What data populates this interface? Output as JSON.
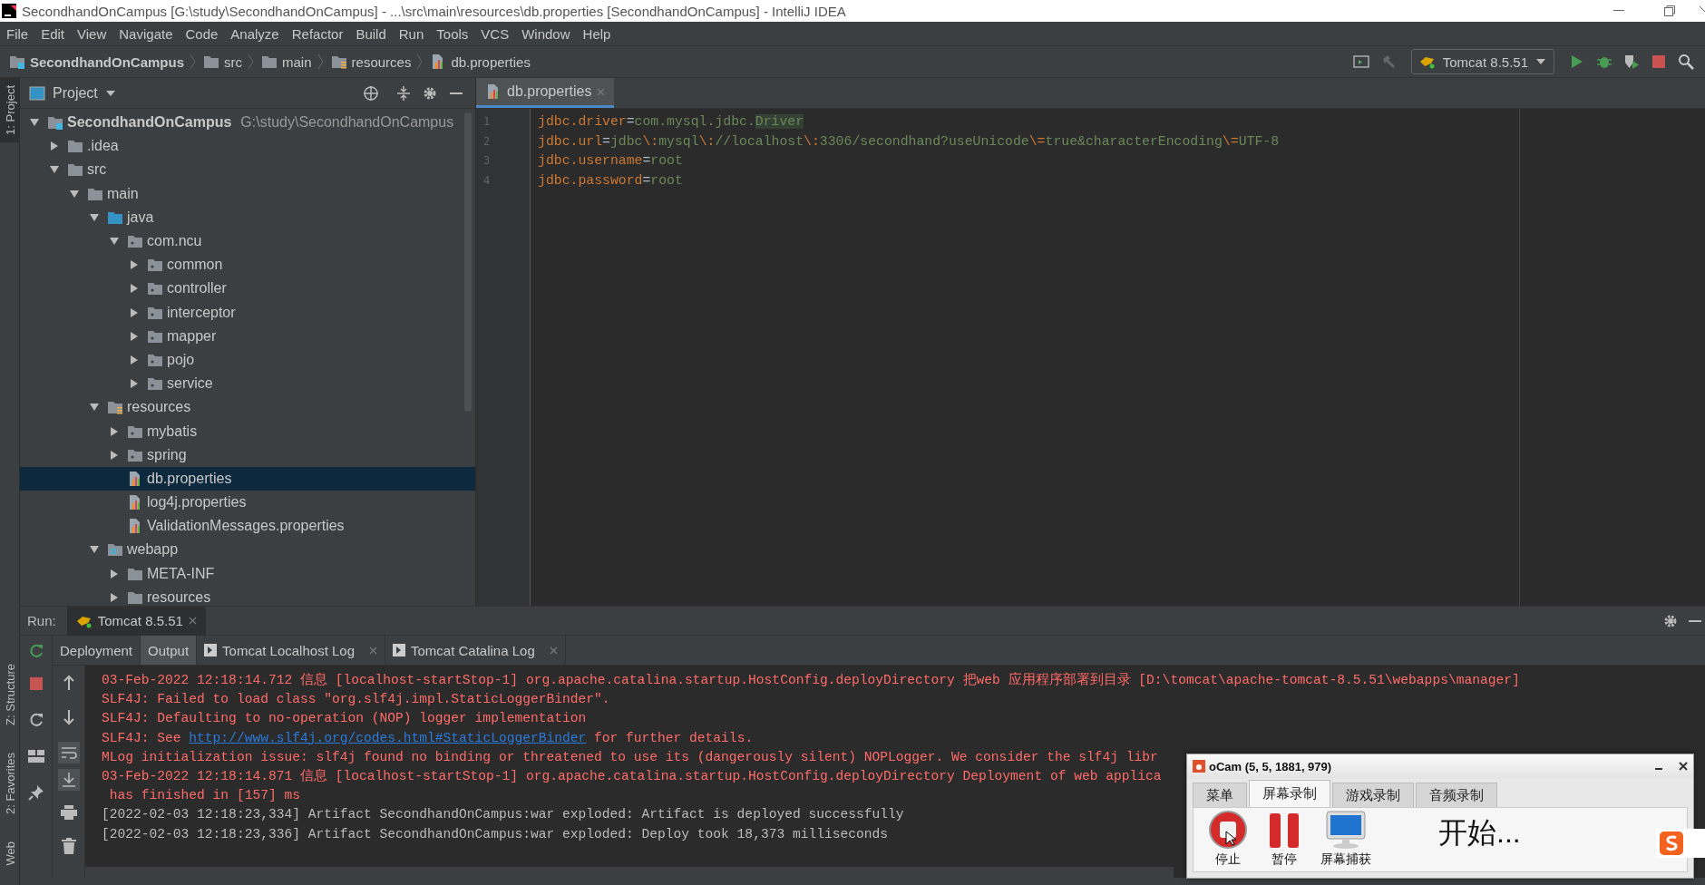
{
  "window": {
    "title": "SecondhandOnCampus [G:\\study\\SecondhandOnCampus] - ...\\src\\main\\resources\\db.properties [SecondhandOnCampus] - IntelliJ IDEA"
  },
  "menu": [
    "File",
    "Edit",
    "View",
    "Navigate",
    "Code",
    "Analyze",
    "Refactor",
    "Build",
    "Run",
    "Tools",
    "VCS",
    "Window",
    "Help"
  ],
  "breadcrumbs": [
    {
      "label": "SecondhandOnCampus",
      "kind": "module"
    },
    {
      "label": "src",
      "kind": "folder"
    },
    {
      "label": "main",
      "kind": "folder"
    },
    {
      "label": "resources",
      "kind": "resources"
    },
    {
      "label": "db.properties",
      "kind": "properties"
    }
  ],
  "run_config": {
    "label": "Tomcat 8.5.51"
  },
  "side_tabs": [
    {
      "label": "1: Project",
      "selected": true,
      "kind": "top"
    },
    {
      "label": "Z: Structure",
      "selected": false,
      "kind": "bottom"
    },
    {
      "label": "2: Favorites",
      "selected": false,
      "kind": "bottom"
    },
    {
      "label": "Web",
      "selected": false,
      "kind": "bottom"
    }
  ],
  "project_panel": {
    "title": "Project",
    "tree": [
      {
        "label": "SecondhandOnCampus",
        "path": "G:\\study\\SecondhandOnCampus",
        "kind": "module",
        "expanded": true,
        "selected": false,
        "children": [
          {
            "label": ".idea",
            "kind": "folder",
            "expanded": false,
            "selected": false
          },
          {
            "label": "src",
            "kind": "folder",
            "expanded": true,
            "selected": false,
            "children": [
              {
                "label": "main",
                "kind": "folder",
                "expanded": true,
                "selected": false,
                "children": [
                  {
                    "label": "java",
                    "kind": "source",
                    "expanded": true,
                    "selected": false,
                    "children": [
                      {
                        "label": "com.ncu",
                        "kind": "package",
                        "expanded": true,
                        "selected": false,
                        "children": [
                          {
                            "label": "common",
                            "kind": "package",
                            "expanded": false,
                            "selected": false
                          },
                          {
                            "label": "controller",
                            "kind": "package",
                            "expanded": false,
                            "selected": false
                          },
                          {
                            "label": "interceptor",
                            "kind": "package",
                            "expanded": false,
                            "selected": false
                          },
                          {
                            "label": "mapper",
                            "kind": "package",
                            "expanded": false,
                            "selected": false
                          },
                          {
                            "label": "pojo",
                            "kind": "package",
                            "expanded": false,
                            "selected": false
                          },
                          {
                            "label": "service",
                            "kind": "package",
                            "expanded": false,
                            "selected": false
                          }
                        ]
                      }
                    ]
                  },
                  {
                    "label": "resources",
                    "kind": "resources",
                    "expanded": true,
                    "selected": false,
                    "children": [
                      {
                        "label": "mybatis",
                        "kind": "package",
                        "expanded": false,
                        "selected": false
                      },
                      {
                        "label": "spring",
                        "kind": "package",
                        "expanded": false,
                        "selected": false
                      },
                      {
                        "label": "db.properties",
                        "kind": "properties",
                        "selected": true
                      },
                      {
                        "label": "log4j.properties",
                        "kind": "properties",
                        "selected": false
                      },
                      {
                        "label": "ValidationMessages.properties",
                        "kind": "properties",
                        "selected": false
                      }
                    ]
                  },
                  {
                    "label": "webapp",
                    "kind": "web",
                    "expanded": true,
                    "selected": false,
                    "children": [
                      {
                        "label": "META-INF",
                        "kind": "folder",
                        "expanded": false,
                        "selected": false
                      },
                      {
                        "label": "resources",
                        "kind": "folder",
                        "expanded": false,
                        "selected": false
                      }
                    ]
                  }
                ]
              }
            ]
          }
        ]
      }
    ]
  },
  "editor": {
    "tabs": [
      {
        "label": "db.properties",
        "selected": true
      }
    ],
    "lines": [
      {
        "number": "1",
        "parts": [
          {
            "text": "jdbc.driver",
            "kind": "key"
          },
          {
            "text": "=",
            "kind": "sep"
          },
          {
            "text": "com.mysql.jdbc.",
            "kind": "value"
          },
          {
            "text": "Driver",
            "kind": "highlight"
          }
        ]
      },
      {
        "number": "2",
        "parts": [
          {
            "text": "jdbc.url",
            "kind": "key"
          },
          {
            "text": "=",
            "kind": "sep"
          },
          {
            "text": "jdbc",
            "kind": "value"
          },
          {
            "text": "\\:",
            "kind": "escape"
          },
          {
            "text": "mysql",
            "kind": "value"
          },
          {
            "text": "\\:",
            "kind": "escape"
          },
          {
            "text": "//localhost",
            "kind": "value"
          },
          {
            "text": "\\:",
            "kind": "escape"
          },
          {
            "text": "3306/secondhand?useUnicode",
            "kind": "value"
          },
          {
            "text": "\\=",
            "kind": "escape"
          },
          {
            "text": "true&characterEncoding",
            "kind": "value"
          },
          {
            "text": "\\=",
            "kind": "escape"
          },
          {
            "text": "UTF-8",
            "kind": "value"
          }
        ]
      },
      {
        "number": "3",
        "parts": [
          {
            "text": "jdbc.username",
            "kind": "key"
          },
          {
            "text": "=",
            "kind": "sep"
          },
          {
            "text": "root",
            "kind": "value"
          }
        ]
      },
      {
        "number": "4",
        "parts": [
          {
            "text": "jdbc.password",
            "kind": "key"
          },
          {
            "text": "=",
            "kind": "sep"
          },
          {
            "text": "root",
            "kind": "value"
          }
        ]
      }
    ]
  },
  "run_panel": {
    "label": "Run:",
    "config_tab": "Tomcat 8.5.51",
    "tabs": [
      {
        "label": "Deployment",
        "selected": false,
        "kind": "plain"
      },
      {
        "label": "Output",
        "selected": true,
        "kind": "plain"
      },
      {
        "label": "Tomcat Localhost Log",
        "selected": false,
        "kind": "log"
      },
      {
        "label": "Tomcat Catalina Log",
        "selected": false,
        "kind": "log"
      }
    ],
    "console": [
      {
        "kind": "error",
        "text": "03-Feb-2022 12:18:14.712 信息 [localhost-startStop-1] org.apache.catalina.startup.HostConfig.deployDirectory 把web 应用程序部署到目录 [D:\\tomcat\\apache-tomcat-8.5.51\\webapps\\manager]"
      },
      {
        "kind": "error",
        "text": "SLF4J: Failed to load class \"org.slf4j.impl.StaticLoggerBinder\"."
      },
      {
        "kind": "error",
        "text": "SLF4J: Defaulting to no-operation (NOP) logger implementation"
      },
      {
        "kind": "link",
        "before": "SLF4J: See ",
        "link": "http://www.slf4j.org/codes.html#StaticLoggerBinder",
        "after": " for further details."
      },
      {
        "kind": "error",
        "text": "MLog initialization issue: slf4j found no binding or threatened to use its (dangerously silent) NOPLogger. We consider the slf4j libr"
      },
      {
        "kind": "error",
        "text": "03-Feb-2022 12:18:14.871 信息 [localhost-startStop-1] org.apache.catalina.startup.HostConfig.deployDirectory Deployment of web applica"
      },
      {
        "kind": "error",
        "text": " has finished in [157] ms"
      },
      {
        "kind": "info",
        "text": "[2022-02-03 12:18:23,334] Artifact SecondhandOnCampus:war exploded: Artifact is deployed successfully"
      },
      {
        "kind": "info",
        "text": "[2022-02-03 12:18:23,336] Artifact SecondhandOnCampus:war exploded: Deploy took 18,373 milliseconds"
      }
    ]
  },
  "ocam": {
    "title": "oCam (5, 5, 1881, 979)",
    "tabs": [
      {
        "label": "菜单",
        "selected": false
      },
      {
        "label": "屏幕录制",
        "selected": true
      },
      {
        "label": "游戏录制",
        "selected": false
      },
      {
        "label": "音频录制",
        "selected": false
      }
    ],
    "buttons": [
      {
        "label": "停止",
        "kind": "stop"
      },
      {
        "label": "暂停",
        "kind": "pause"
      },
      {
        "label": "屏幕捕获",
        "kind": "capture"
      }
    ],
    "status": "开始..."
  }
}
